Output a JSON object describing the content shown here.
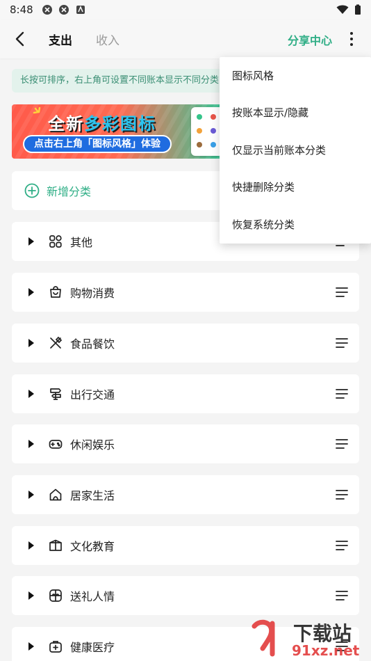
{
  "status_bar": {
    "time": "8:48"
  },
  "header": {
    "tabs": [
      {
        "label": "支出",
        "active": true
      },
      {
        "label": "收入",
        "active": false
      }
    ],
    "share_label": "分享中心"
  },
  "tip": "长按可排序，右上角可设置不同账本显示不同分类",
  "banner": {
    "headline_prefix": "全新",
    "headline_highlight": "多彩图标",
    "cta": "点击右上角「图标风格」体验"
  },
  "add_category": {
    "label": "新增分类"
  },
  "categories": [
    {
      "label": "其他",
      "icon": "grid-icon"
    },
    {
      "label": "购物消费",
      "icon": "shopping-bag-icon"
    },
    {
      "label": "食品餐饮",
      "icon": "utensils-icon"
    },
    {
      "label": "出行交通",
      "icon": "signpost-icon"
    },
    {
      "label": "休闲娱乐",
      "icon": "gamepad-icon"
    },
    {
      "label": "居家生活",
      "icon": "home-icon"
    },
    {
      "label": "文化教育",
      "icon": "book-icon"
    },
    {
      "label": "送礼人情",
      "icon": "gift-icon"
    },
    {
      "label": "健康医疗",
      "icon": "medkit-icon"
    }
  ],
  "menu": {
    "items": [
      {
        "label": "图标风格"
      },
      {
        "label": "按账本显示/隐藏"
      },
      {
        "label": "仅显示当前账本分类"
      },
      {
        "label": "快捷删除分类"
      },
      {
        "label": "恢复系统分类"
      }
    ]
  },
  "watermark": {
    "text": "下载站",
    "domain": "91xz.net"
  },
  "colors": {
    "accent": "#2fae86",
    "tip_bg": "#e3f2ec",
    "background": "#f4f4f4"
  }
}
